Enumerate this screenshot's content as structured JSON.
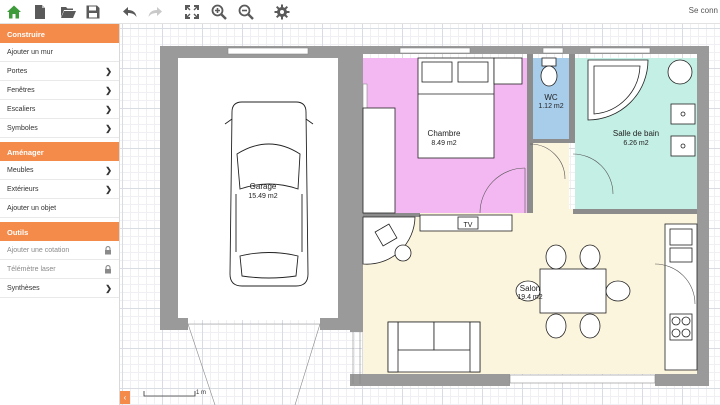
{
  "toolbar": {
    "buttons": [
      {
        "name": "home",
        "icon": "home-icon"
      },
      {
        "name": "new-file",
        "icon": "file-icon"
      },
      {
        "name": "open",
        "icon": "folder-open-icon"
      },
      {
        "name": "save",
        "icon": "floppy-icon"
      },
      {
        "name": "undo",
        "icon": "undo-icon"
      },
      {
        "name": "redo",
        "icon": "redo-icon"
      },
      {
        "name": "fullscreen",
        "icon": "fullscreen-icon"
      },
      {
        "name": "zoom-in",
        "icon": "zoom-in-icon"
      },
      {
        "name": "zoom-out",
        "icon": "zoom-out-icon"
      },
      {
        "name": "settings",
        "icon": "gear-icon"
      }
    ],
    "status": "Se conn",
    "colors": {
      "home": "#3e9b3a",
      "icon": "#5a5a5a",
      "disabled": "#c9c9c9"
    }
  },
  "sidebar": {
    "accent": "#f58b4a",
    "sections": [
      {
        "title": "Construire",
        "items": [
          {
            "label": "Ajouter un mur",
            "chevron": false,
            "locked": false
          },
          {
            "label": "Portes",
            "chevron": true,
            "locked": false
          },
          {
            "label": "Fenêtres",
            "chevron": true,
            "locked": false
          },
          {
            "label": "Escaliers",
            "chevron": true,
            "locked": false
          },
          {
            "label": "Symboles",
            "chevron": true,
            "locked": false
          }
        ]
      },
      {
        "title": "Aménager",
        "items": [
          {
            "label": "Meubles",
            "chevron": true,
            "locked": false
          },
          {
            "label": "Extérieurs",
            "chevron": true,
            "locked": false
          },
          {
            "label": "Ajouter un objet",
            "chevron": false,
            "locked": false
          }
        ]
      },
      {
        "title": "Outils",
        "items": [
          {
            "label": "Ajouter une cotation",
            "chevron": false,
            "locked": true
          },
          {
            "label": "Télémètre laser",
            "chevron": false,
            "locked": true
          },
          {
            "label": "Synthèses",
            "chevron": true,
            "locked": false
          }
        ]
      }
    ],
    "collapse_glyph": "‹"
  },
  "plan": {
    "rooms": [
      {
        "id": "garage",
        "name": "Garage",
        "area": "15.49 m2",
        "color": "#ffffff"
      },
      {
        "id": "chambre",
        "name": "Chambre",
        "area": "8.49 m2",
        "color": "#f3b8f1"
      },
      {
        "id": "wc",
        "name": "WC",
        "area": "1.12 m2",
        "color": "#a8cdeb"
      },
      {
        "id": "sdb",
        "name": "Salle de bain",
        "area": "6.26 m2",
        "color": "#c4efe4"
      },
      {
        "id": "salon",
        "name": "Salon",
        "area": "19.4 m2",
        "color": "#fcf5dd"
      }
    ],
    "tv_label": "TV",
    "wall_color": "#9a9a9a",
    "scale_label": "1 m"
  }
}
